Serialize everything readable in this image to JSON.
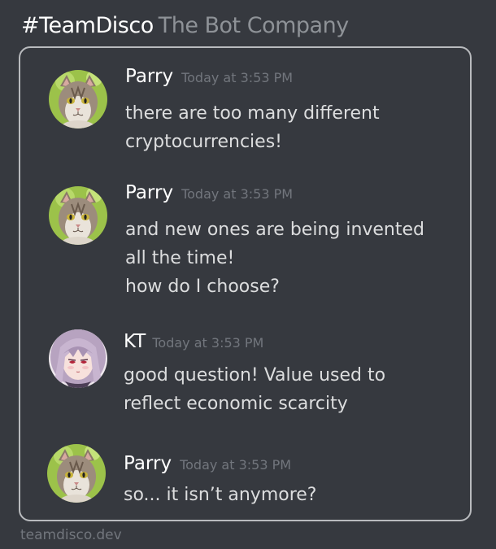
{
  "header": {
    "channel": "#TeamDisco",
    "company": "The Bot Company"
  },
  "messages": [
    {
      "author": "Parry",
      "avatar_icon": "cat-avatar-icon",
      "timestamp": "Today at 3:53 PM",
      "lines": [
        "there are too many different",
        "cryptocurrencies!"
      ]
    },
    {
      "author": "Parry",
      "avatar_icon": "cat-avatar-icon",
      "timestamp": "Today at 3:53 PM",
      "lines": [
        "and new ones are being invented",
        "all the time!",
        "how do I choose?"
      ]
    },
    {
      "author": "KT",
      "avatar_icon": "anime-girl-avatar-icon",
      "timestamp": "Today at 3:53 PM",
      "lines": [
        "good question! Value used to",
        "reflect economic scarcity"
      ]
    },
    {
      "author": "Parry",
      "avatar_icon": "cat-avatar-icon",
      "timestamp": "Today at 3:53 PM",
      "lines": [
        "so... it isn’t anymore?"
      ]
    }
  ],
  "footer": {
    "site": "teamdisco.dev"
  },
  "colors": {
    "background": "#36393f",
    "author": "#ffffff",
    "timestamp": "#72767d",
    "message_text": "#dcddde",
    "frame_border": "#b9bbbe"
  }
}
